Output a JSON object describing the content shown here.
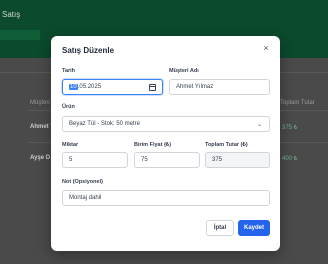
{
  "background": {
    "header_title": "Satış",
    "table_header_left": "Müşteri",
    "table_header_right": "Toplam Tutar",
    "row1_customer": "Ahmet Y",
    "row1_total": "375 ₺",
    "row2_customer": "Ayşe D",
    "row2_total": "400 ₺"
  },
  "modal": {
    "title": "Satış Düzenle",
    "close_label": "×",
    "date": {
      "label": "Tarih",
      "day": "10",
      "rest": ".05.2025"
    },
    "customer": {
      "label": "Müşteri Adı",
      "value": "Ahmet Yılmaz"
    },
    "product": {
      "label": "Ürün",
      "value": "Beyaz Tül - Stok: 50 metre"
    },
    "quantity": {
      "label": "Miktar",
      "value": "5"
    },
    "unit_price": {
      "label": "Birim Fiyat (₺)",
      "value": "75"
    },
    "total": {
      "label": "Toplam Tutar (₺)",
      "value": "375"
    },
    "note": {
      "label": "Not (Opsiyonel)",
      "value": "Montaj dahil"
    },
    "cancel_label": "İptal",
    "save_label": "Kaydet"
  }
}
